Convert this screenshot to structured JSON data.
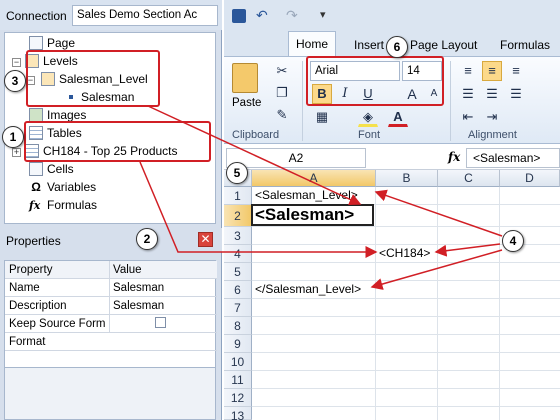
{
  "connection": {
    "label": "Connection",
    "value": "Sales Demo Section Ac"
  },
  "tree": {
    "page": "Page",
    "levels": "Levels",
    "salesman_level": "Salesman_Level",
    "salesman": "Salesman",
    "images": "Images",
    "tables": "Tables",
    "table_item": "CH184 - Top 25 Products",
    "cells": "Cells",
    "variables": "Variables",
    "formulas": "Formulas"
  },
  "properties": {
    "title": "Properties",
    "close": "✕",
    "header": [
      "Property",
      "Value"
    ],
    "rows": [
      [
        "Name",
        "Salesman"
      ],
      [
        "Description",
        "Salesman"
      ],
      [
        "Keep Source Format",
        ""
      ],
      [
        "Format",
        ""
      ]
    ]
  },
  "ribbon": {
    "tabs": [
      "Home",
      "Insert",
      "Page Layout",
      "Formulas"
    ],
    "font_name": "Arial",
    "font_size": "14",
    "paste": "Paste",
    "groups": [
      "Clipboard",
      "Font",
      "Alignment"
    ],
    "bold": "B",
    "italic": "I",
    "underline": "U",
    "grow": "A",
    "shrink": "A"
  },
  "formula_bar": {
    "name_box": "A2",
    "fx": "fx",
    "value": "<Salesman>"
  },
  "grid": {
    "columns": [
      "A",
      "B",
      "C",
      "D"
    ],
    "rows": [
      "1",
      "2",
      "3",
      "4",
      "5",
      "6",
      "7",
      "8",
      "9",
      "10",
      "11",
      "12",
      "13"
    ],
    "cells": {
      "a1": "<Salesman_Level>",
      "a2": "<Salesman>",
      "b4": "<CH184>",
      "a6": "</Salesman_Level>"
    }
  },
  "callouts": [
    "1",
    "2",
    "3",
    "4",
    "5",
    "6"
  ],
  "colors": {
    "callout_red": "#d11f25",
    "accent": "#2b579a"
  }
}
